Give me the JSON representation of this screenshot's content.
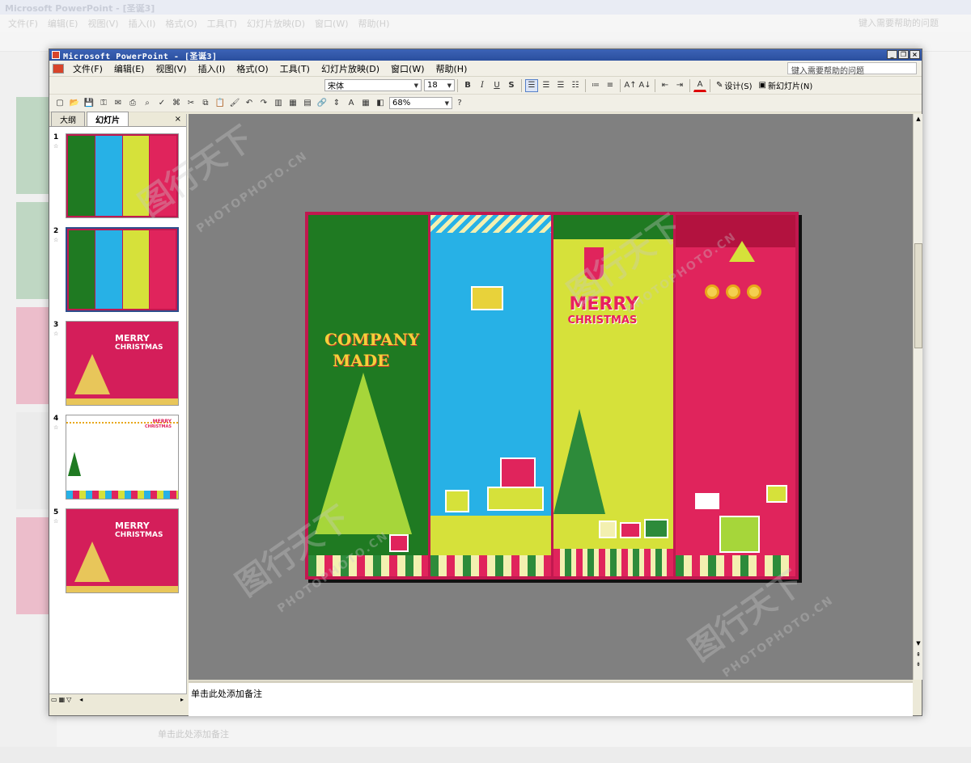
{
  "background": {
    "title": "Microsoft PowerPoint - [圣诞3]",
    "menu": [
      "文件(F)",
      "编辑(E)",
      "视图(V)",
      "插入(I)",
      "格式(O)",
      "工具(T)",
      "幻灯片放映(D)",
      "窗口(W)",
      "帮助(H)"
    ],
    "ask": "键入需要帮助的问题",
    "notes": "单击此处添加备注"
  },
  "window": {
    "title": "Microsoft PowerPoint - [圣诞3]",
    "menu": [
      "文件(F)",
      "编辑(E)",
      "视图(V)",
      "插入(I)",
      "格式(O)",
      "工具(T)",
      "幻灯片放映(D)",
      "窗口(W)",
      "帮助(H)"
    ],
    "ask_placeholder": "键入需要帮助的问题"
  },
  "formatting": {
    "font": "宋体",
    "size": "18",
    "bold": "B",
    "italic": "I",
    "underline": "U",
    "shadow": "S",
    "design": "设计(S)",
    "new_slide": "新幻灯片(N)"
  },
  "standard": {
    "zoom": "68%"
  },
  "left_pane": {
    "tabs": [
      "大纲",
      "幻灯片"
    ],
    "close": "×",
    "slides": [
      "1",
      "2",
      "3",
      "4",
      "5"
    ],
    "selected_slide": "2"
  },
  "slide": {
    "panel1_text_line1": "COMPANY",
    "panel1_text_line2": "MADE",
    "panel3_text_line1": "MERRY",
    "panel3_text_line2": "CHRISTMAS"
  },
  "thumbs": {
    "merry": "MERRY",
    "christmas": "CHRISTMAS"
  },
  "notes": {
    "placeholder": "单击此处添加备注"
  },
  "watermark": {
    "brand": "图行天下",
    "url": "PHOTOPHOTO.CN"
  },
  "colors": {
    "green": "#1f7a22",
    "blue": "#27b1e6",
    "lime": "#d6e13a",
    "pink": "#e0245c",
    "frame": "#c1184f"
  }
}
